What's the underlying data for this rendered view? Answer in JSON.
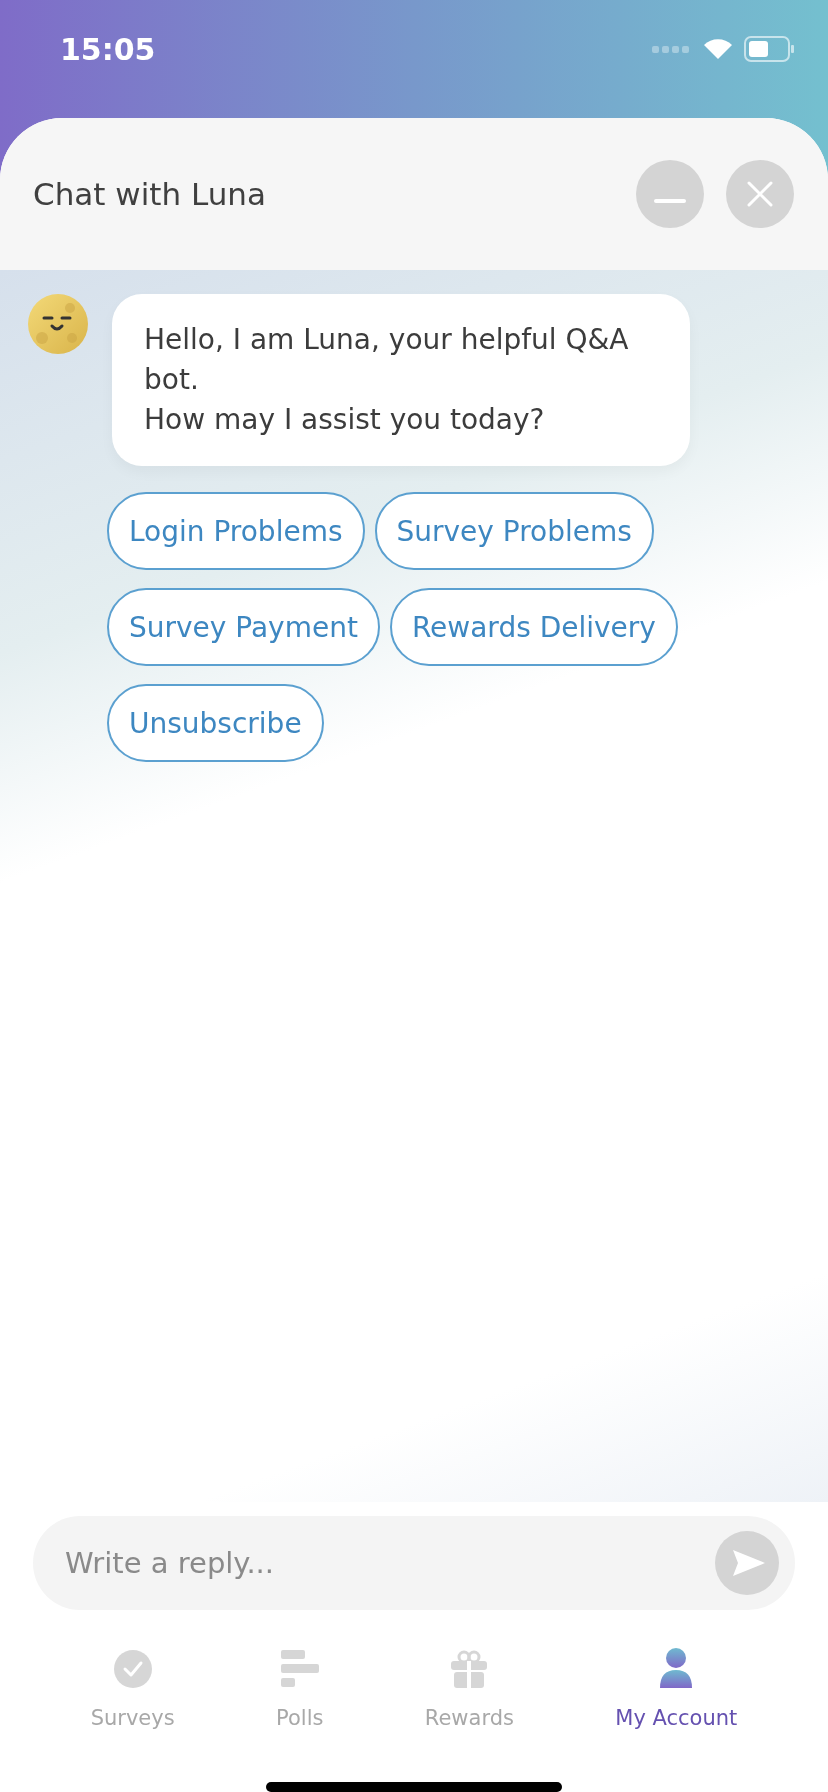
{
  "status_bar": {
    "time": "15:05"
  },
  "header": {
    "title": "Chat with Luna"
  },
  "messages": [
    {
      "kind": "bot",
      "text": "Hello, I am Luna, your helpful Q&A bot.\nHow may I assist you today?"
    }
  ],
  "quick_replies": [
    "Login Problems",
    "Survey Problems",
    "Survey Payment",
    "Rewards Delivery",
    "Unsubscribe"
  ],
  "composer": {
    "placeholder": "Write a reply..."
  },
  "tabs": [
    {
      "label": "Surveys",
      "kind": "check",
      "selected": false
    },
    {
      "label": "Polls",
      "kind": "bars",
      "selected": false
    },
    {
      "label": "Rewards",
      "kind": "gift",
      "selected": false
    },
    {
      "label": "My Account",
      "kind": "person",
      "selected": true
    }
  ]
}
